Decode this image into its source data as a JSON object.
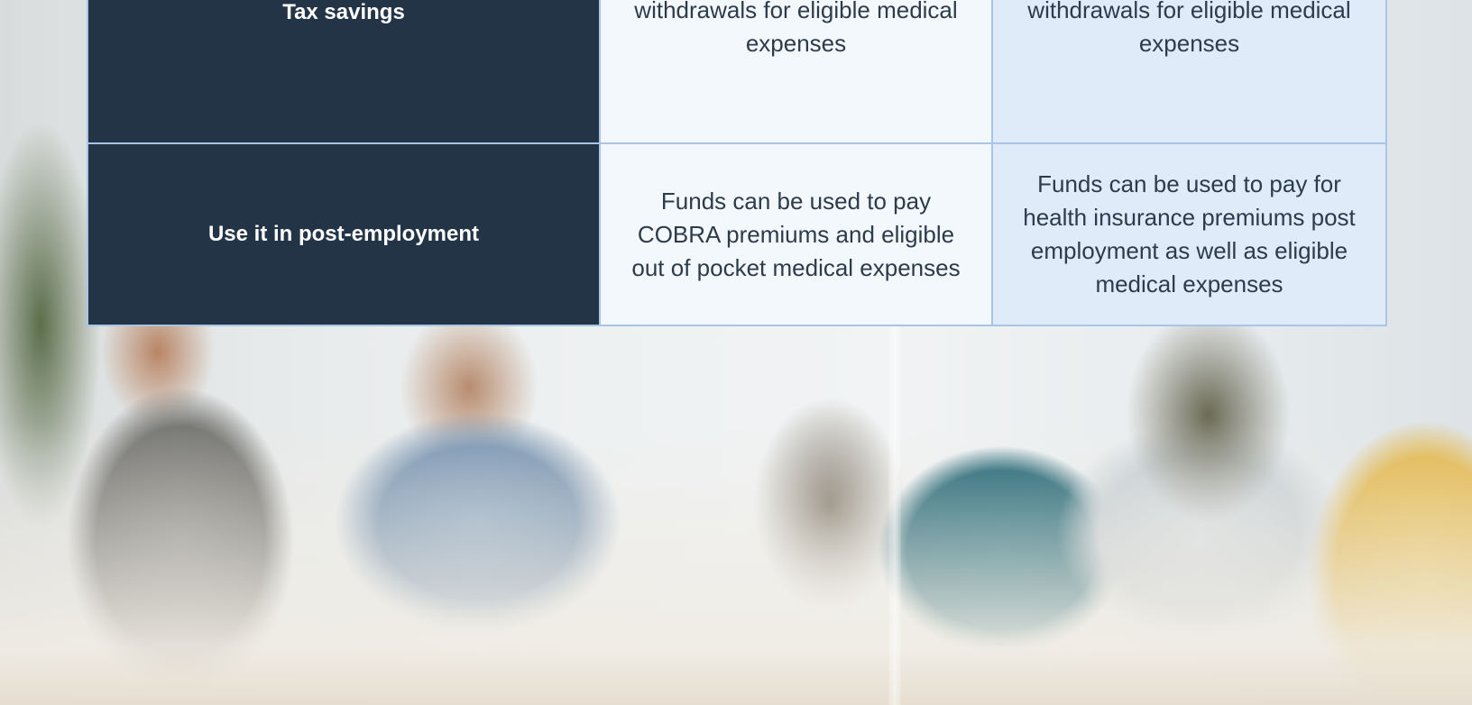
{
  "colors": {
    "label_cell_bg": "#233447",
    "fsa_cell_bg": "#f3f8fd",
    "hra_cell_bg": "#dfebf8",
    "border": "#a9c5e6",
    "text_dark": "#2d3b4a"
  },
  "comparison_table": {
    "rows": [
      {
        "label": "Tax savings",
        "col1": "Contributions, earnings and withdrawals for eligible medical expenses",
        "col2": "Contributions, earnings and withdrawals for eligible medical expenses"
      },
      {
        "label": "Use it in post-employment",
        "col1": "Funds can be used to pay COBRA premiums and eligible out of pocket medical expenses",
        "col2": "Funds can be used to pay for health insurance premiums post employment as well as eligible medical expenses"
      }
    ]
  },
  "background_image": {
    "icon": "office-meeting-photo"
  }
}
